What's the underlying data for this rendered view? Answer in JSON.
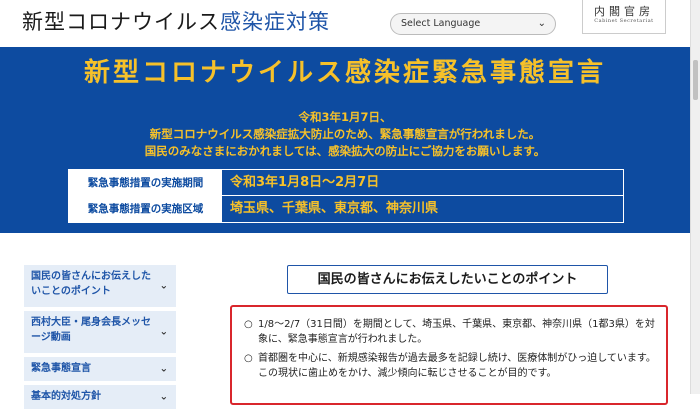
{
  "header": {
    "title_part1": "新型コロナウイルス",
    "title_part2": "感染症対策",
    "language_select": "Select Language",
    "logo_jp": "内閣官房",
    "logo_en": "Cabinet Secretariat"
  },
  "banner": {
    "title": "新型コロナウイルス感染症緊急事態宣言",
    "line1": "令和3年1月7日、",
    "line2": "新型コロナウイルス感染症拡大防止のため、緊急事態宣言が行われました。",
    "line3": "国民のみなさまにおかれましては、感染拡大の防止にご協力をお願いします。",
    "rows": [
      {
        "label": "緊急事態措置の実施期間",
        "value": "令和3年1月8日～2月7日"
      },
      {
        "label": "緊急事態措置の実施区域",
        "value": "埼玉県、千葉県、東京都、神奈川県"
      }
    ]
  },
  "sidebar": {
    "items": [
      {
        "label": "国民の皆さんにお伝えしたいことのポイント"
      },
      {
        "label": "西村大臣・尾身会長メッセージ動画"
      },
      {
        "label": "緊急事態宣言"
      },
      {
        "label": "基本的対処方針"
      }
    ]
  },
  "main": {
    "heading": "国民の皆さんにお伝えしたいことのポイント",
    "bullet": "○",
    "points": [
      "1/8～2/7（31日間）を期間として、埼玉県、千葉県、東京都、神奈川県（1都3県）を対象に、緊急事態宣言が行われました。",
      "首都圏を中心に、新規感染報告が過去最多を記録し続け、医療体制がひっ迫しています。この現状に歯止めをかけ、減少傾向に転じさせることが目的です。"
    ]
  },
  "colors": {
    "banner_bg": "#0d4ba0",
    "banner_text": "#f6c12a",
    "accent_blue": "#1f55a8",
    "alert_red": "#d9262c"
  },
  "icons": {
    "chevron": "chevron-down-icon"
  }
}
